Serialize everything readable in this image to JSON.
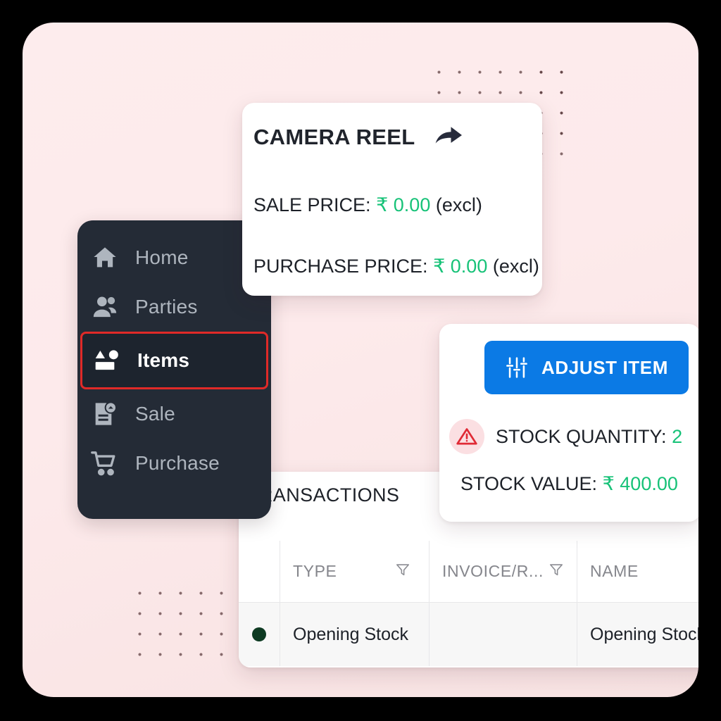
{
  "theme": {
    "page_background": "#000000",
    "panel_background": "#fdeced",
    "sidebar_background": "#242b36",
    "active_outline": "#e02a28",
    "accent_blue": "#0b7ae5",
    "money_green": "#17c278",
    "warning_red": "#e02a35",
    "dot_green": "#0d3a22"
  },
  "sidebar": {
    "items": [
      {
        "label": "Home",
        "icon": "home-icon",
        "active": false
      },
      {
        "label": "Parties",
        "icon": "people-icon",
        "active": false
      },
      {
        "label": "Items",
        "icon": "items-icon",
        "active": true
      },
      {
        "label": "Sale",
        "icon": "sale-doc-icon",
        "active": false
      },
      {
        "label": "Purchase",
        "icon": "cart-icon",
        "active": false
      }
    ]
  },
  "item_card": {
    "title": "CAMERA REEL",
    "share_icon": "share-arrow-icon",
    "sale_price_label": "SALE PRICE:",
    "sale_price_currency": "₹",
    "sale_price_value": "0.00",
    "sale_price_suffix": "(excl)",
    "purchase_price_label": "PURCHASE PRICE:",
    "purchase_price_currency": "₹",
    "purchase_price_value": "0.00",
    "purchase_price_suffix": "(excl)"
  },
  "stock_card": {
    "adjust_button_label": "ADJUST ITEM",
    "adjust_button_icon": "sliders-icon",
    "warning_icon": "warning-triangle-icon",
    "stock_quantity_label": "STOCK QUANTITY:",
    "stock_quantity_value": "2",
    "stock_value_label": "STOCK VALUE:",
    "stock_value_currency": "₹",
    "stock_value_amount": "400.00"
  },
  "transactions": {
    "title": "TRANSACTIONS",
    "columns": [
      {
        "label": "",
        "filter": false
      },
      {
        "label": "TYPE",
        "filter": true
      },
      {
        "label": "INVOICE/R...",
        "filter": true
      },
      {
        "label": "NAME",
        "filter": false
      }
    ],
    "rows": [
      {
        "status_dot": "status-dot-green",
        "type": "Opening Stock",
        "invoice": "",
        "name": "Opening Stock"
      }
    ]
  }
}
